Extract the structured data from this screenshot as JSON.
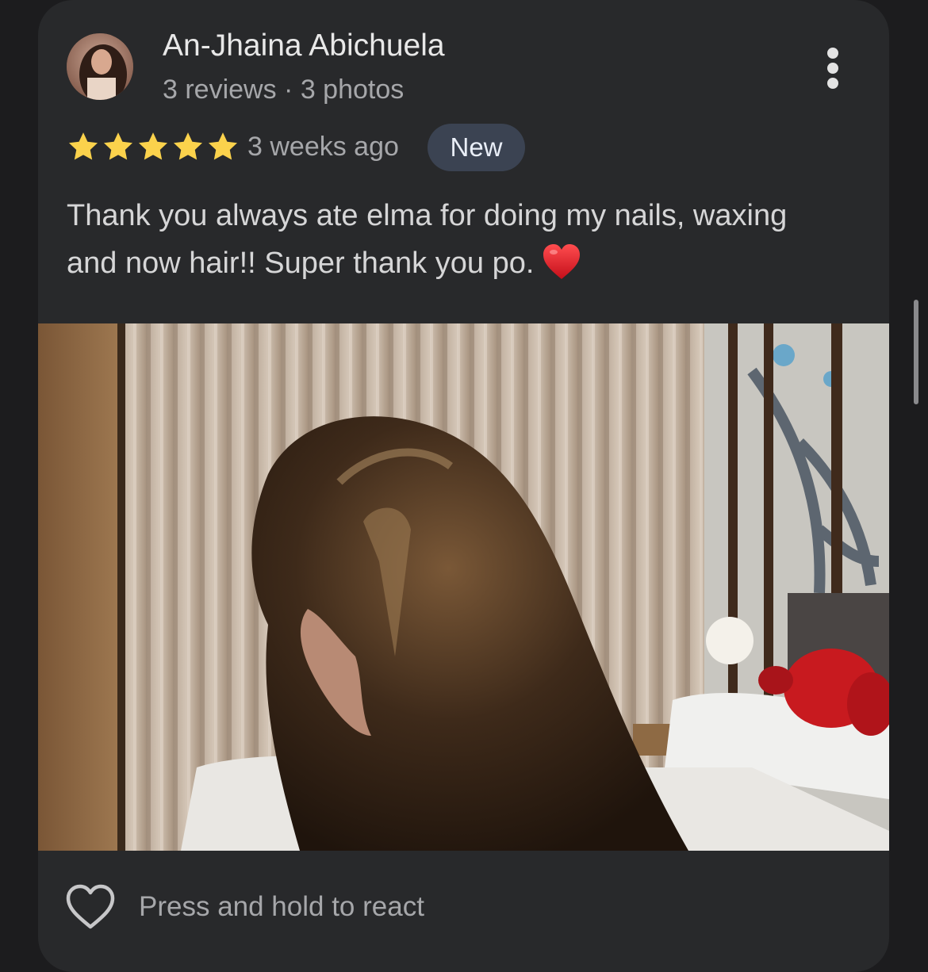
{
  "review": {
    "author": "An-Jhaina Abichuela",
    "author_stats": "3 reviews · 3 photos",
    "rating": 5,
    "time_ago": "3 weeks ago",
    "badge": "New",
    "text": "Thank you always ate elma for doing my nails, waxing and now hair!! Super thank you po."
  },
  "actions": {
    "react_label": "Press and hold to react"
  },
  "colors": {
    "star": "#fbd24c",
    "card_bg": "#28292b",
    "badge_bg": "#3b4352"
  },
  "icons": {
    "more": "more-vertical-icon",
    "react": "heart-outline-icon",
    "emoji": "red-heart-emoji"
  }
}
